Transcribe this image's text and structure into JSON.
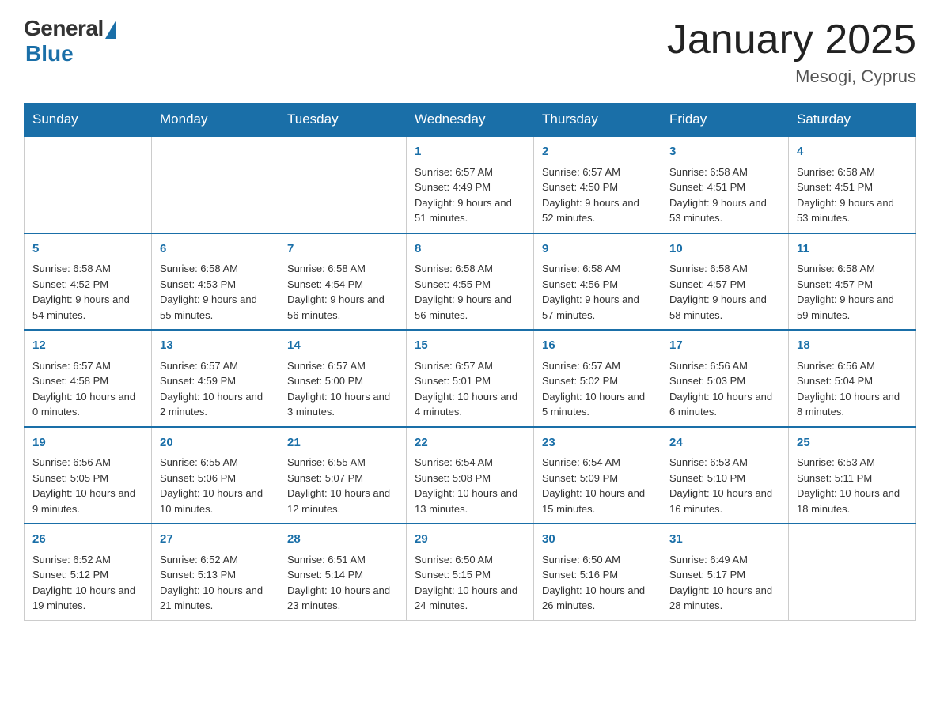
{
  "header": {
    "logo_general": "General",
    "logo_blue": "Blue",
    "title": "January 2025",
    "location": "Mesogi, Cyprus"
  },
  "days_of_week": [
    "Sunday",
    "Monday",
    "Tuesday",
    "Wednesday",
    "Thursday",
    "Friday",
    "Saturday"
  ],
  "weeks": [
    [
      {
        "day": "",
        "info": ""
      },
      {
        "day": "",
        "info": ""
      },
      {
        "day": "",
        "info": ""
      },
      {
        "day": "1",
        "info": "Sunrise: 6:57 AM\nSunset: 4:49 PM\nDaylight: 9 hours and 51 minutes."
      },
      {
        "day": "2",
        "info": "Sunrise: 6:57 AM\nSunset: 4:50 PM\nDaylight: 9 hours and 52 minutes."
      },
      {
        "day": "3",
        "info": "Sunrise: 6:58 AM\nSunset: 4:51 PM\nDaylight: 9 hours and 53 minutes."
      },
      {
        "day": "4",
        "info": "Sunrise: 6:58 AM\nSunset: 4:51 PM\nDaylight: 9 hours and 53 minutes."
      }
    ],
    [
      {
        "day": "5",
        "info": "Sunrise: 6:58 AM\nSunset: 4:52 PM\nDaylight: 9 hours and 54 minutes."
      },
      {
        "day": "6",
        "info": "Sunrise: 6:58 AM\nSunset: 4:53 PM\nDaylight: 9 hours and 55 minutes."
      },
      {
        "day": "7",
        "info": "Sunrise: 6:58 AM\nSunset: 4:54 PM\nDaylight: 9 hours and 56 minutes."
      },
      {
        "day": "8",
        "info": "Sunrise: 6:58 AM\nSunset: 4:55 PM\nDaylight: 9 hours and 56 minutes."
      },
      {
        "day": "9",
        "info": "Sunrise: 6:58 AM\nSunset: 4:56 PM\nDaylight: 9 hours and 57 minutes."
      },
      {
        "day": "10",
        "info": "Sunrise: 6:58 AM\nSunset: 4:57 PM\nDaylight: 9 hours and 58 minutes."
      },
      {
        "day": "11",
        "info": "Sunrise: 6:58 AM\nSunset: 4:57 PM\nDaylight: 9 hours and 59 minutes."
      }
    ],
    [
      {
        "day": "12",
        "info": "Sunrise: 6:57 AM\nSunset: 4:58 PM\nDaylight: 10 hours and 0 minutes."
      },
      {
        "day": "13",
        "info": "Sunrise: 6:57 AM\nSunset: 4:59 PM\nDaylight: 10 hours and 2 minutes."
      },
      {
        "day": "14",
        "info": "Sunrise: 6:57 AM\nSunset: 5:00 PM\nDaylight: 10 hours and 3 minutes."
      },
      {
        "day": "15",
        "info": "Sunrise: 6:57 AM\nSunset: 5:01 PM\nDaylight: 10 hours and 4 minutes."
      },
      {
        "day": "16",
        "info": "Sunrise: 6:57 AM\nSunset: 5:02 PM\nDaylight: 10 hours and 5 minutes."
      },
      {
        "day": "17",
        "info": "Sunrise: 6:56 AM\nSunset: 5:03 PM\nDaylight: 10 hours and 6 minutes."
      },
      {
        "day": "18",
        "info": "Sunrise: 6:56 AM\nSunset: 5:04 PM\nDaylight: 10 hours and 8 minutes."
      }
    ],
    [
      {
        "day": "19",
        "info": "Sunrise: 6:56 AM\nSunset: 5:05 PM\nDaylight: 10 hours and 9 minutes."
      },
      {
        "day": "20",
        "info": "Sunrise: 6:55 AM\nSunset: 5:06 PM\nDaylight: 10 hours and 10 minutes."
      },
      {
        "day": "21",
        "info": "Sunrise: 6:55 AM\nSunset: 5:07 PM\nDaylight: 10 hours and 12 minutes."
      },
      {
        "day": "22",
        "info": "Sunrise: 6:54 AM\nSunset: 5:08 PM\nDaylight: 10 hours and 13 minutes."
      },
      {
        "day": "23",
        "info": "Sunrise: 6:54 AM\nSunset: 5:09 PM\nDaylight: 10 hours and 15 minutes."
      },
      {
        "day": "24",
        "info": "Sunrise: 6:53 AM\nSunset: 5:10 PM\nDaylight: 10 hours and 16 minutes."
      },
      {
        "day": "25",
        "info": "Sunrise: 6:53 AM\nSunset: 5:11 PM\nDaylight: 10 hours and 18 minutes."
      }
    ],
    [
      {
        "day": "26",
        "info": "Sunrise: 6:52 AM\nSunset: 5:12 PM\nDaylight: 10 hours and 19 minutes."
      },
      {
        "day": "27",
        "info": "Sunrise: 6:52 AM\nSunset: 5:13 PM\nDaylight: 10 hours and 21 minutes."
      },
      {
        "day": "28",
        "info": "Sunrise: 6:51 AM\nSunset: 5:14 PM\nDaylight: 10 hours and 23 minutes."
      },
      {
        "day": "29",
        "info": "Sunrise: 6:50 AM\nSunset: 5:15 PM\nDaylight: 10 hours and 24 minutes."
      },
      {
        "day": "30",
        "info": "Sunrise: 6:50 AM\nSunset: 5:16 PM\nDaylight: 10 hours and 26 minutes."
      },
      {
        "day": "31",
        "info": "Sunrise: 6:49 AM\nSunset: 5:17 PM\nDaylight: 10 hours and 28 minutes."
      },
      {
        "day": "",
        "info": ""
      }
    ]
  ]
}
